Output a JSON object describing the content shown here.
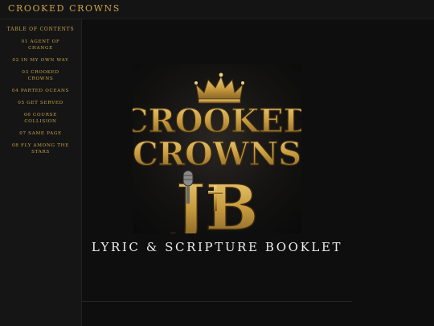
{
  "header": {
    "site_title": "CROOKED CROWNS"
  },
  "sidebar": {
    "heading": "TABLE OF CONTENTS",
    "items": [
      {
        "label": "01 AGENT OF CHANGE"
      },
      {
        "label": "02 IN MY OWN WAY"
      },
      {
        "label": "03 CROOKED CROWNS"
      },
      {
        "label": "04 PARTED OCEANS"
      },
      {
        "label": "05 GET SERVED"
      },
      {
        "label": "06 COURSE COLLISION"
      },
      {
        "label": "07 SAME PAGE"
      },
      {
        "label": "08 FLY AMONG THE STARS"
      }
    ]
  },
  "cover": {
    "title_line1": "CROOKED",
    "title_line2": "CROWNS",
    "monogram": "JB"
  },
  "main": {
    "booklet_title": "LYRIC & SCRIPTURE BOOKLET"
  },
  "colors": {
    "accent": "#c9a24a",
    "background": "#0b0b0b",
    "sidebar": "#151515"
  }
}
